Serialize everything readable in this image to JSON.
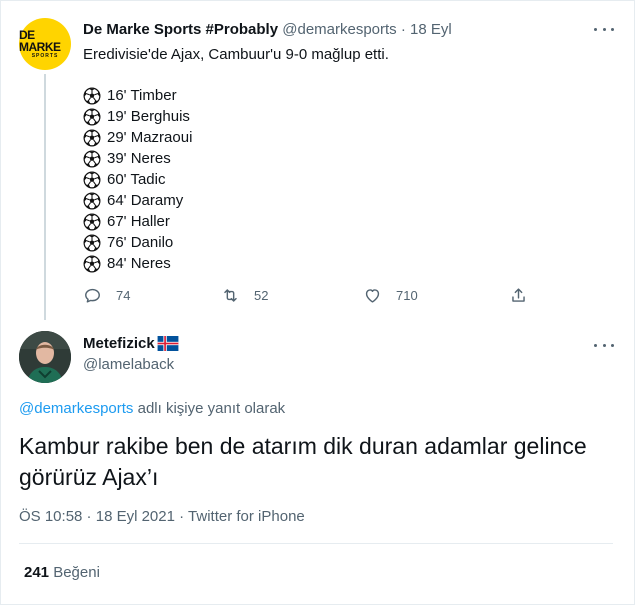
{
  "tweet1": {
    "avatar_text": "DE MARKE",
    "avatar_subtext": "SPORTS",
    "name": "De Marke Sports #Probably",
    "handle": "@demarkesports",
    "separator": "·",
    "date": "18 Eyl",
    "text": "Eredivisie'de Ajax, Cambuur'u 9-0 mağlup etti.",
    "goals": [
      {
        "icon": "soccer-ball-icon",
        "label": "16' Timber"
      },
      {
        "icon": "soccer-ball-icon",
        "label": "19' Berghuis"
      },
      {
        "icon": "soccer-ball-icon",
        "label": "29' Mazraoui"
      },
      {
        "icon": "soccer-ball-icon",
        "label": "39' Neres"
      },
      {
        "icon": "soccer-ball-icon",
        "label": "60' Tadic"
      },
      {
        "icon": "soccer-ball-icon",
        "label": "64' Daramy"
      },
      {
        "icon": "soccer-ball-icon",
        "label": "67' Haller"
      },
      {
        "icon": "soccer-ball-icon",
        "label": "76' Danilo"
      },
      {
        "icon": "soccer-ball-icon",
        "label": "84' Neres"
      }
    ],
    "actions": {
      "reply_count": "74",
      "retweet_count": "52",
      "like_count": "710"
    }
  },
  "tweet2": {
    "name": "Metefizick",
    "flag_icon": "iceland-flag-icon",
    "handle": "@lamelaback",
    "reply_mention": "@demarkesports",
    "reply_suffix": " adlı kişiye yanıt olarak",
    "text": "Kambur rakibe ben de atarım dik duran adamlar gelince görürüz Ajax’ı",
    "time": "ÖS 10:58",
    "separator": " · ",
    "date": "18 Eyl 2021",
    "source": "Twitter for iPhone",
    "like_count": "241",
    "like_label": "Beğeni"
  },
  "colors": {
    "accent": "#1d9bf0",
    "secondary_text": "#536471",
    "brand_yellow": "#ffd400"
  }
}
